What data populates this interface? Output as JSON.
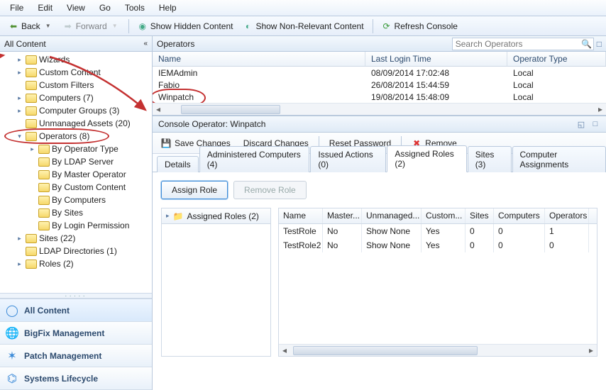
{
  "menu": {
    "file": "File",
    "edit": "Edit",
    "view": "View",
    "go": "Go",
    "tools": "Tools",
    "help": "Help"
  },
  "toolbar": {
    "back": "Back",
    "forward": "Forward",
    "show_hidden": "Show Hidden Content",
    "show_nonrelevant": "Show Non-Relevant Content",
    "refresh": "Refresh Console"
  },
  "sidebar": {
    "header": "All Content",
    "items": [
      {
        "label": "Wizards",
        "indent": 1,
        "exp": "▸"
      },
      {
        "label": "Custom Content",
        "indent": 1,
        "exp": "▸"
      },
      {
        "label": "Custom Filters",
        "indent": 1,
        "exp": ""
      },
      {
        "label": "Computers (7)",
        "indent": 1,
        "exp": "▸"
      },
      {
        "label": "Computer Groups (3)",
        "indent": 1,
        "exp": "▸"
      },
      {
        "label": "Unmanaged Assets (20)",
        "indent": 1,
        "exp": ""
      },
      {
        "label": "Operators (8)",
        "indent": 1,
        "exp": "▾",
        "circled": true
      },
      {
        "label": "By Operator Type",
        "indent": 2,
        "exp": "▸"
      },
      {
        "label": "By LDAP Server",
        "indent": 2,
        "exp": ""
      },
      {
        "label": "By Master Operator",
        "indent": 2,
        "exp": ""
      },
      {
        "label": "By Custom Content",
        "indent": 2,
        "exp": ""
      },
      {
        "label": "By Computers",
        "indent": 2,
        "exp": ""
      },
      {
        "label": "By Sites",
        "indent": 2,
        "exp": ""
      },
      {
        "label": "By Login Permission",
        "indent": 2,
        "exp": ""
      },
      {
        "label": "Sites (22)",
        "indent": 1,
        "exp": "▸"
      },
      {
        "label": "LDAP Directories (1)",
        "indent": 1,
        "exp": ""
      },
      {
        "label": "Roles (2)",
        "indent": 1,
        "exp": "▸"
      }
    ]
  },
  "domains": [
    {
      "label": "All Content",
      "icon": "◯",
      "selected": true
    },
    {
      "label": "BigFix Management",
      "icon": "🌐"
    },
    {
      "label": "Patch Management",
      "icon": "✶"
    },
    {
      "label": "Systems Lifecycle",
      "icon": "⌬"
    }
  ],
  "list": {
    "title": "Operators",
    "search_placeholder": "Search Operators",
    "cols": {
      "name": "Name",
      "time": "Last Login Time",
      "type": "Operator Type"
    },
    "rows": [
      {
        "name": "IEMAdmin",
        "time": "08/09/2014 17:02:48",
        "type": "Local"
      },
      {
        "name": "Fabio",
        "time": "26/08/2014 15:44:59",
        "type": "Local"
      },
      {
        "name": "Winpatch",
        "time": "19/08/2014 15:48:09",
        "type": "Local",
        "sel": true
      }
    ]
  },
  "detail": {
    "title": "Console Operator: Winpatch",
    "toolbar": {
      "save": "Save Changes",
      "discard": "Discard Changes",
      "reset": "Reset Password",
      "remove": "Remove"
    },
    "tabs": [
      "Details",
      "Administered Computers (4)",
      "Issued Actions (0)",
      "Assigned Roles (2)",
      "Sites (3)",
      "Computer Assignments"
    ],
    "active_tab": 3,
    "buttons": {
      "assign": "Assign Role",
      "remove": "Remove Role"
    },
    "role_tree_header": "Assigned Roles (2)",
    "role_cols": [
      "Name",
      "Master...",
      "Unmanaged...",
      "Custom...",
      "Sites",
      "Computers",
      "Operators"
    ],
    "role_rows": [
      {
        "c": [
          "TestRole",
          "No",
          "Show None",
          "Yes",
          "0",
          "0",
          "1"
        ]
      },
      {
        "c": [
          "TestRole2",
          "No",
          "Show None",
          "Yes",
          "0",
          "0",
          "0"
        ]
      }
    ]
  }
}
